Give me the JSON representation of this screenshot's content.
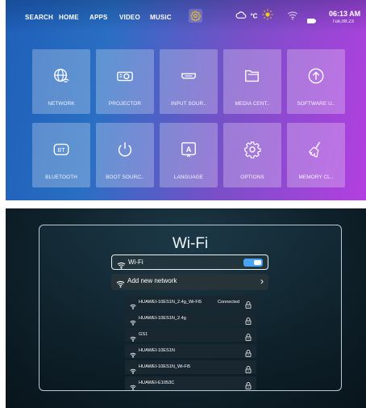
{
  "top_nav": {
    "items": [
      "SEARCH",
      "HOME",
      "APPS",
      "VIDEO",
      "MUSIC"
    ],
    "active_icon": "gear-icon"
  },
  "status": {
    "weather": "°C",
    "time": "06:13 AM",
    "date": "Tue,08.23"
  },
  "tiles": [
    {
      "label": "NETWORK",
      "icon": "network-globe-icon"
    },
    {
      "label": "PROJECTOR",
      "icon": "projector-icon"
    },
    {
      "label": "INPUT SOUR..",
      "icon": "hdmi-icon"
    },
    {
      "label": "MEDIA CENT..",
      "icon": "folder-icon"
    },
    {
      "label": "SOFTWARE U..",
      "icon": "upload-arrow-icon"
    },
    {
      "label": "BLUETOOTH",
      "icon": "bluetooth-bt-icon"
    },
    {
      "label": "BOOT SOURC..",
      "icon": "power-icon"
    },
    {
      "label": "LANGUAGE",
      "icon": "language-a-icon"
    },
    {
      "label": "OPTIONS",
      "icon": "gear-icon"
    },
    {
      "label": "MEMORY CL..",
      "icon": "broom-icon"
    }
  ],
  "wifi": {
    "title": "Wi-Fi",
    "toggle_label": "Wi-Fi",
    "toggle_on": true,
    "add_network_label": "Add new network",
    "networks": [
      {
        "name": "HUAWEI-10ES1N_2.4g_Wi-Fi5",
        "status": "Connected",
        "locked": true
      },
      {
        "name": "HUAWEI-10ES1N_2.4g",
        "status": "",
        "locked": true
      },
      {
        "name": "GS1",
        "status": "",
        "locked": true
      },
      {
        "name": "HUAWEI-10ES1N",
        "status": "",
        "locked": true
      },
      {
        "name": "HUAWEI-10ES1N_Wi-Fi5",
        "status": "",
        "locked": true
      },
      {
        "name": "HUAWEI-E1053C",
        "status": "",
        "locked": true
      }
    ]
  },
  "colors": {
    "toggle_accent": "#4aa3f5",
    "weather_sun": "#f5c518",
    "launcher_gradient_start": "#1f5fb8",
    "launcher_gradient_end": "#b33fe0"
  }
}
